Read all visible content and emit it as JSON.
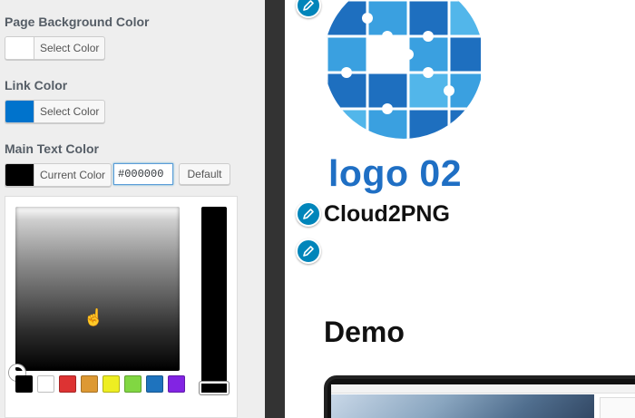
{
  "panel": {
    "page_bg": {
      "title": "Page Background Color",
      "button_label": "Select Color",
      "swatch_color": "#ffffff"
    },
    "link": {
      "title": "Link Color",
      "button_label": "Select Color",
      "swatch_color": "#0073cc"
    },
    "main_text": {
      "title": "Main Text Color",
      "button_label": "Current Color",
      "swatch_color": "#000000",
      "hex_value": "#000000",
      "default_label": "Default"
    },
    "palette": [
      "#000000",
      "#ffffff",
      "#dd3333",
      "#dd9933",
      "#eeee22",
      "#81d742",
      "#1e73be",
      "#8224e3"
    ]
  },
  "preview": {
    "site_title": "logo 02",
    "tagline": "Cloud2PNG",
    "heading": "Demo",
    "accent_color": "#1f6fc4"
  },
  "icons": {
    "edit": "pencil-icon",
    "logo": "puzzle-globe-logo"
  }
}
